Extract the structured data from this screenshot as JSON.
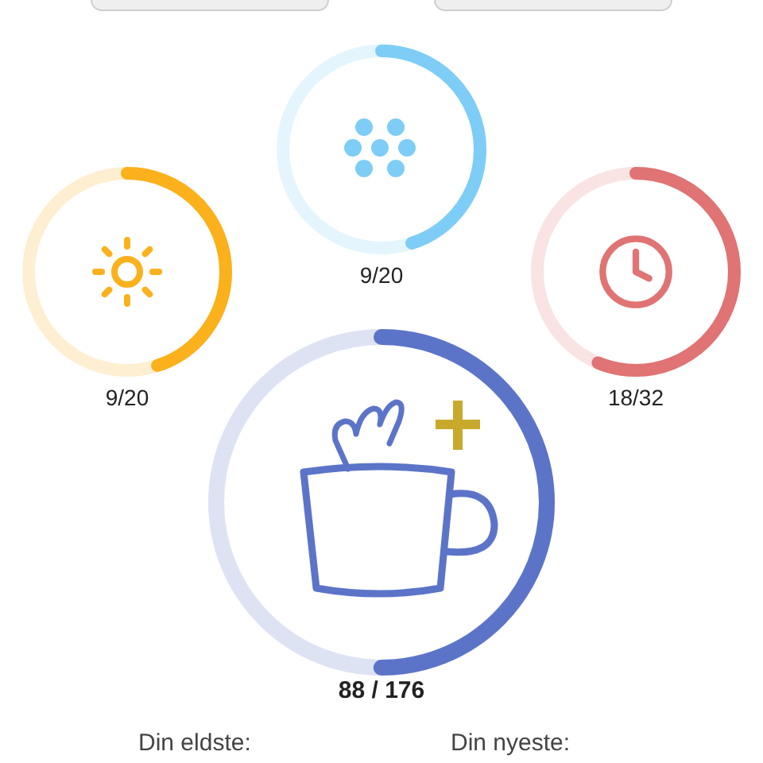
{
  "rings": [
    {
      "label": "9/20",
      "color": "#7ecdf6"
    },
    {
      "label": "9/20",
      "color": "#fbb11c"
    },
    {
      "label": "18/32",
      "color": "#e07373"
    }
  ],
  "total": {
    "label": "88 / 176",
    "color": "#5c74c8"
  },
  "footer": {
    "oldest_label": "Din eldste:",
    "newest_label": "Din nyeste:"
  }
}
